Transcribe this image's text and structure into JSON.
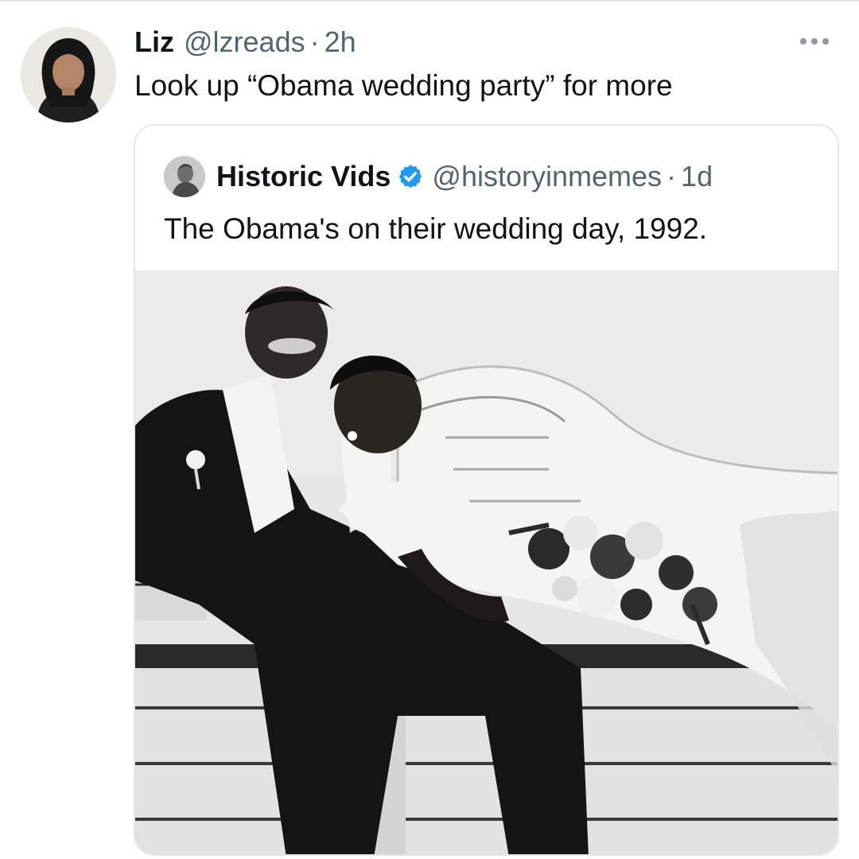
{
  "tweet": {
    "author_name": "Liz",
    "author_handle": "@lzreads",
    "separator": "·",
    "time": "2h",
    "text": "Look up “Obama wedding party” for more",
    "avatar_icon": "profile-photo",
    "more_icon": "more-horizontal-icon"
  },
  "quoted_tweet": {
    "author_name": "Historic Vids",
    "verified_icon": "verified-badge-icon",
    "verified_color": "#1d9bf0",
    "author_handle": "@historyinmemes",
    "separator": "·",
    "time": "1d",
    "text": "The Obama's on their wedding day, 1992.",
    "avatar_icon": "profile-photo",
    "media": {
      "type": "photo",
      "style": "black-and-white"
    }
  },
  "colors": {
    "text_primary": "#0f1419",
    "text_secondary": "#536471",
    "border": "#e3e7ea"
  }
}
